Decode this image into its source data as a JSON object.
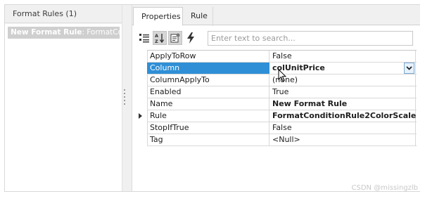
{
  "left_panel": {
    "header": "Format Rules (1)",
    "items": [
      {
        "bold": "New Format Rule",
        "rest": ": FormatCor"
      }
    ]
  },
  "tabs": [
    {
      "label": "Properties",
      "active": true
    },
    {
      "label": "Rule",
      "active": false
    }
  ],
  "toolbar": {
    "buttons": [
      "categorized-icon",
      "alphabetical-sort-icon",
      "property-pages-icon",
      "events-lightning-icon"
    ],
    "search_placeholder": "Enter text to search..."
  },
  "grid": {
    "rows": [
      {
        "name": "ApplyToRow",
        "value": "False",
        "bold": false
      },
      {
        "name": "Column",
        "value": "colUnitPrice",
        "bold": true,
        "selected": true
      },
      {
        "name": "ColumnApplyTo",
        "value": "(none)",
        "bold": false
      },
      {
        "name": "Enabled",
        "value": "True",
        "bold": false
      },
      {
        "name": "Name",
        "value": "New Format Rule",
        "bold": true
      },
      {
        "name": "Rule",
        "value": "FormatConditionRule2ColorScale",
        "bold": true,
        "current": true
      },
      {
        "name": "StopIfTrue",
        "value": "False",
        "bold": false
      },
      {
        "name": "Tag",
        "value": "<Null>",
        "bold": false
      }
    ]
  },
  "watermark": "CSDN @missingzlb",
  "colors": {
    "selection": "#2f8fd6",
    "panel_bg": "#f0f0f0",
    "list_item_bg": "#cfcfcf"
  }
}
